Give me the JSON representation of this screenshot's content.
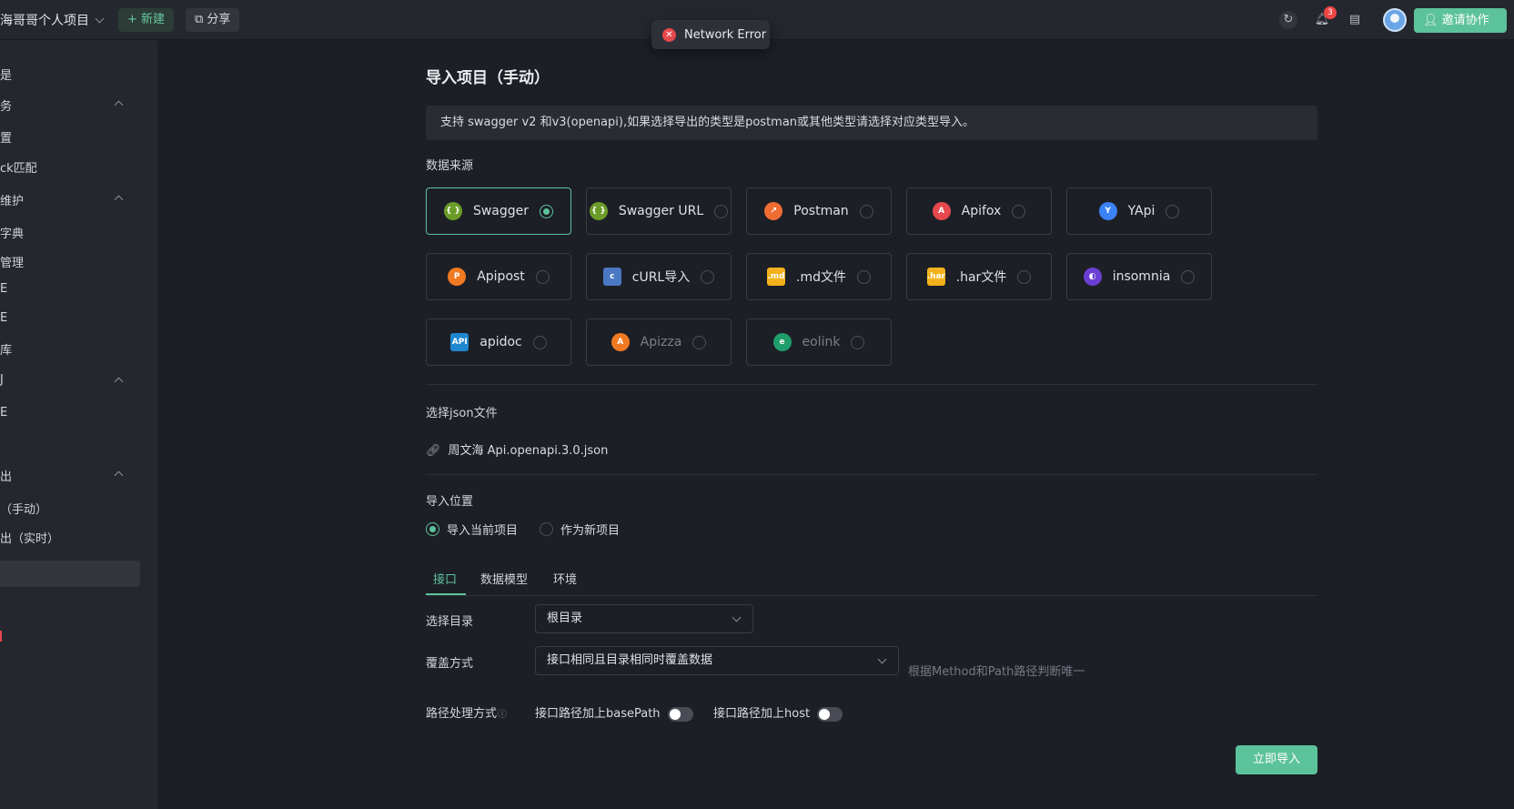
{
  "header": {
    "project_name": "海哥哥个人项目",
    "new_label": "+ 新建",
    "share_label": "分享",
    "notification_count": "3",
    "invite_label": "邀请协作"
  },
  "toast": {
    "text": "Network Error"
  },
  "sidebar": {
    "items": [
      {
        "label": "是"
      },
      {
        "label": "务"
      },
      {
        "label": "置"
      },
      {
        "label": "ck匹配"
      },
      {
        "label": "维护"
      },
      {
        "label": "字典"
      },
      {
        "label": "管理"
      },
      {
        "label": "E"
      },
      {
        "label": "E"
      },
      {
        "label": "库"
      },
      {
        "label": "J"
      },
      {
        "label": "E"
      },
      {
        "label": "出"
      },
      {
        "label": "（手动）"
      },
      {
        "label": "出（实时）"
      }
    ]
  },
  "page": {
    "title": "导入项目（手动）",
    "notice": "支持 swagger v2 和v3(openapi),如果选择导出的类型是postman或其他类型请选择对应类型导入。",
    "source_label": "数据来源",
    "sources": [
      {
        "label": "Swagger",
        "icon": "{ }",
        "color": "#6a9c28",
        "selected": true
      },
      {
        "label": "Swagger URL",
        "icon": "{ }",
        "color": "#6a9c28"
      },
      {
        "label": "Postman",
        "icon": "↗",
        "color": "#ef6c33"
      },
      {
        "label": "Apifox",
        "icon": "A",
        "color": "#e5484d"
      },
      {
        "label": "YApi",
        "icon": "Y",
        "color": "#3b82f6"
      },
      {
        "label": "Apipost",
        "icon": "P",
        "color": "#f07a22"
      },
      {
        "label": "cURL导入",
        "icon": "c",
        "color": "#4a78c2"
      },
      {
        "label": ".md文件",
        "icon": ".md",
        "color": "#f2b21b"
      },
      {
        "label": ".har文件",
        "icon": ".har",
        "color": "#f2b21b"
      },
      {
        "label": "insomnia",
        "icon": "◐",
        "color": "#6b3fd4"
      },
      {
        "label": "apidoc",
        "icon": "API",
        "color": "#1f86d0"
      },
      {
        "label": "Apizza",
        "icon": "A",
        "color": "#f07a22",
        "disabled": true
      },
      {
        "label": "eolink",
        "icon": "e",
        "color": "#1f9d6b",
        "disabled": true
      }
    ],
    "file_label": "选择json文件",
    "file_name": "周文海 Api.openapi.3.0.json",
    "location_label": "导入位置",
    "location_options": [
      "导入当前项目",
      "作为新项目"
    ],
    "tabs": [
      "接口",
      "数据模型",
      "环境"
    ],
    "dir_label": "选择目录",
    "dir_value": "根目录",
    "overwrite_label": "覆盖方式",
    "overwrite_value": "接口相同且目录相同时覆盖数据",
    "overwrite_hint": "根据Method和Path路径判断唯一",
    "path_label": "路径处理方式",
    "toggle_basepath": "接口路径加上basePath",
    "toggle_host": "接口路径加上host",
    "import_button": "立即导入"
  }
}
